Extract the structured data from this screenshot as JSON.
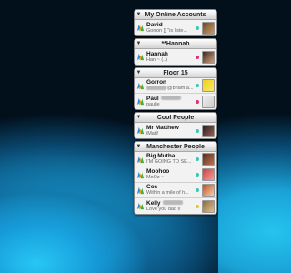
{
  "colors": {
    "dot_online": "#3cc8b4",
    "dot_away": "#e0307a",
    "dot_idle": "#e8c040"
  },
  "groups": [
    {
      "title": "My Online Accounts",
      "items": [
        {
          "name": "David",
          "status": "Gorron [] \"is liste...",
          "dot": "#3cc8b4",
          "avatar": [
            "#6b4a2a",
            "#c89a60"
          ]
        }
      ]
    },
    {
      "title": "**Hannah",
      "items": [
        {
          "name": "Hannah",
          "status": "Han ~ (..)",
          "dot": "#e0307a",
          "avatar": [
            "#3a2a20",
            "#d0a080"
          ]
        }
      ]
    },
    {
      "title": "Floor 15",
      "items": [
        {
          "name": "Gorron",
          "status": "@bham.a...",
          "dot": "#3cc8b4",
          "avatar": [
            "#f0d020",
            "#f8e860"
          ],
          "blur_before_status": true
        },
        {
          "name": "Paul",
          "status": "paulie",
          "dot": "#e0307a",
          "avatar": [
            "#eeeeee",
            "#cccccc"
          ],
          "blur_name": true
        }
      ]
    },
    {
      "title": "Cool People",
      "items": [
        {
          "name": "Mr Matthew",
          "status": "iMatt!",
          "dot": "#3cc8b4",
          "avatar": [
            "#202020",
            "#a06050"
          ]
        }
      ]
    },
    {
      "title": "Manchester People",
      "items": [
        {
          "name": "Big Mutha",
          "status": "I'M GOING TO SE...",
          "dot": "#3cc8b4",
          "avatar": [
            "#503020",
            "#c07050"
          ]
        },
        {
          "name": "Moohoo",
          "status": "MoOz ~",
          "dot": "#3cc8b4",
          "avatar": [
            "#d04040",
            "#f0a0a0"
          ]
        },
        {
          "name": "Cos",
          "status": "Within a mile of h...",
          "dot": "#3cc8b4",
          "avatar": [
            "#c05020",
            "#f0d0b0"
          ]
        },
        {
          "name": "Kelly",
          "status": "Love you dad x",
          "dot": "#e8c040",
          "avatar": [
            "#8a6a40",
            "#e0c090"
          ],
          "blur_name": true
        }
      ]
    }
  ]
}
